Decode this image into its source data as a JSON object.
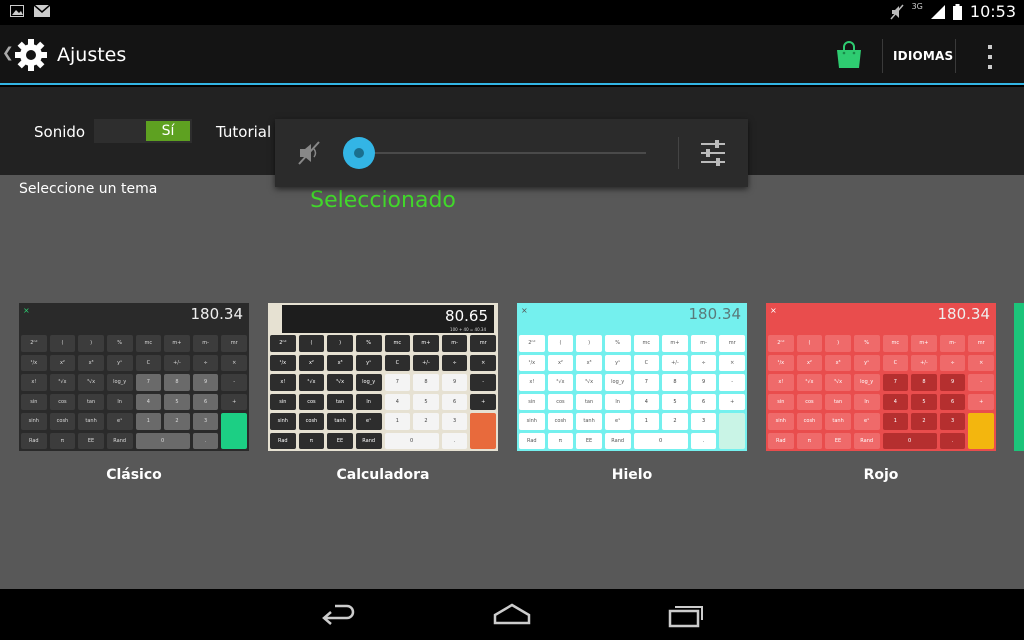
{
  "statusbar": {
    "time": "10:53",
    "network": "3G",
    "icons": [
      "image-icon",
      "mail-icon",
      "mute-icon",
      "signal-icon",
      "battery-icon"
    ]
  },
  "actionbar": {
    "back_glyph": "❮",
    "title": "Ajustes",
    "languages_label": "IDIOMAS",
    "icons": [
      "gear-icon",
      "shopping-bag-icon",
      "overflow-menu-icon"
    ],
    "colors": {
      "accent_line": "#33b5e5",
      "bag": "#2ecc71"
    }
  },
  "settings": {
    "sound_label": "Sonido",
    "sound_toggle_value": "Sí",
    "tutorial_label": "Tutorial"
  },
  "volume_popup": {
    "level": 0,
    "icons": [
      "volume-muted-icon",
      "equalizer-settings-icon"
    ]
  },
  "main": {
    "title": "Seleccione un tema",
    "selected_label": "Seleccionado",
    "themes": [
      {
        "name": "Clásico",
        "display": "180.34",
        "sub": "",
        "selected": false,
        "colors": {
          "body": "#2a2a2a",
          "key": "#3c3c3c",
          "num": "#6a6a6a",
          "eq": "#1ccf84",
          "text": "#ddd"
        }
      },
      {
        "name": "Calculadora",
        "display": "80.65",
        "sub": "100 + 40 = 40.34",
        "selected": true,
        "colors": {
          "body": "#e6e1d2",
          "key": "#2d2d2d",
          "num": "#f4f4f4",
          "eq": "#e86a3c",
          "text": "#fff"
        }
      },
      {
        "name": "Hielo",
        "display": "180.34",
        "sub": "",
        "selected": false,
        "colors": {
          "body": "#74f0ee",
          "key": "#ffffff",
          "num": "#ffffff",
          "eq": "#c9f4e6",
          "text": "#555"
        }
      },
      {
        "name": "Rojo",
        "display": "180.34",
        "sub": "",
        "selected": false,
        "colors": {
          "body": "#e94d4d",
          "key": "#ef6a6a",
          "num": "#b52f2f",
          "eq": "#f3b60e",
          "text": "#fff"
        }
      }
    ],
    "key_rows": [
      [
        "2ⁿᵈ",
        "(",
        ")",
        "%",
        "mc",
        "m+",
        "m-",
        "mr"
      ],
      [
        "¹/x",
        "x²",
        "x³",
        "yˣ",
        "C",
        "+/-",
        "÷",
        "×"
      ],
      [
        "x!",
        "²√x",
        "³√x",
        "log_y",
        "7",
        "8",
        "9",
        "-"
      ],
      [
        "sin",
        "cos",
        "tan",
        "ln",
        "4",
        "5",
        "6",
        "+"
      ],
      [
        "sinh",
        "cosh",
        "tanh",
        "eˣ",
        "1",
        "2",
        "3",
        "="
      ],
      [
        "Rad",
        "π",
        "EE",
        "Rand",
        "0",
        ".",
        ""
      ]
    ]
  },
  "navbar": {
    "icons": [
      "nav-back-icon",
      "nav-home-icon",
      "nav-recent-apps-icon"
    ]
  }
}
